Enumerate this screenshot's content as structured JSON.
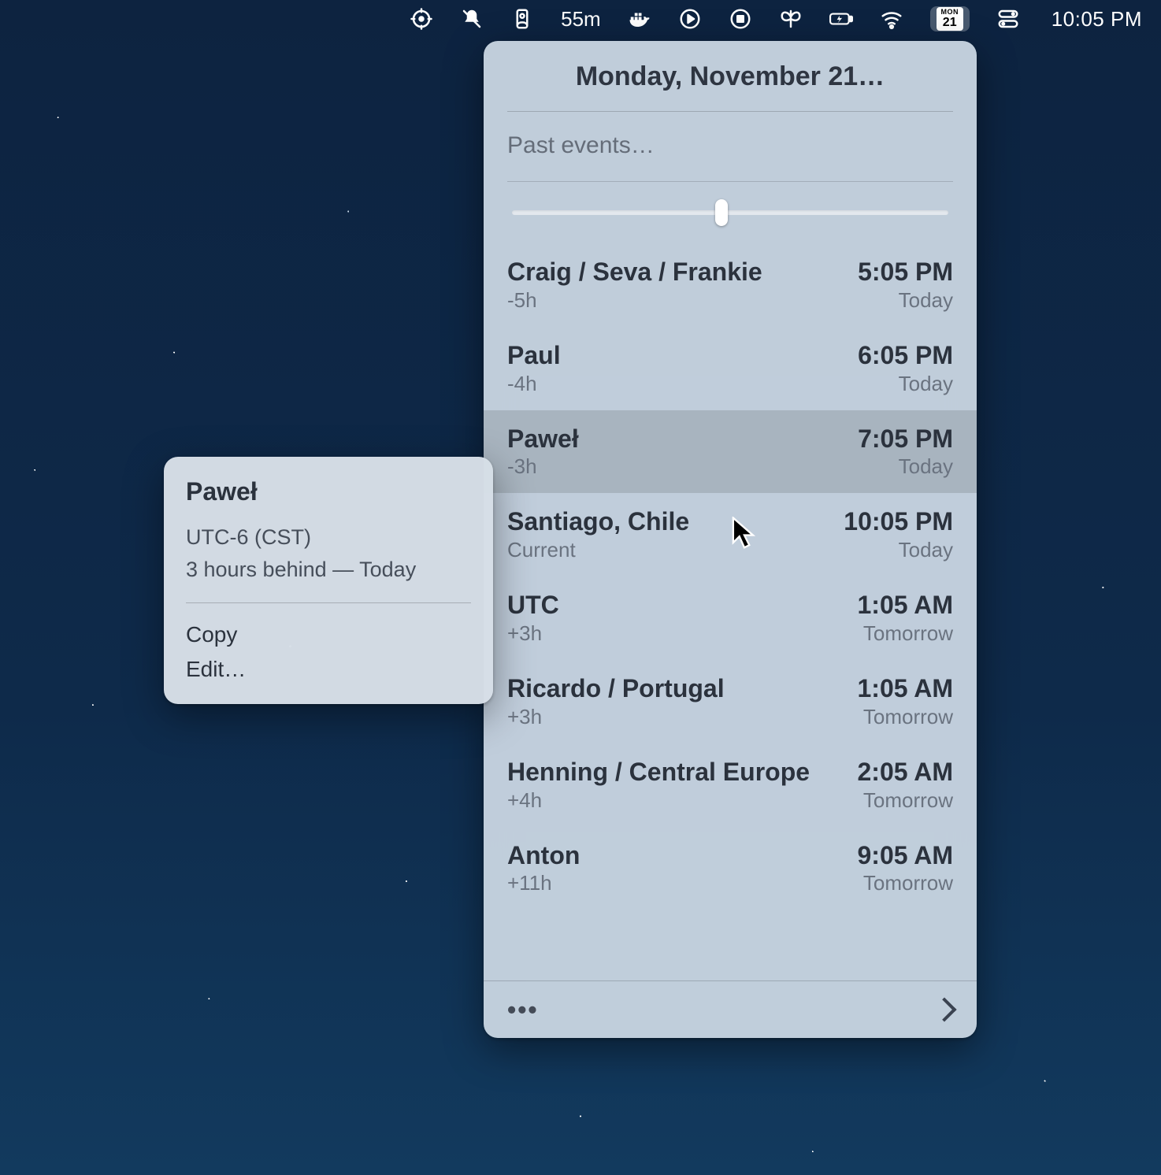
{
  "menubar": {
    "timer": "55m",
    "calendar_badge": {
      "dow": "MON",
      "day": "21"
    },
    "clock": "10:05 PM"
  },
  "panel": {
    "title": "Monday, November 21…",
    "past_events": "Past events…",
    "rows": [
      {
        "name": "Craig / Seva / Frankie",
        "offset": "-5h",
        "time": "5:05 PM",
        "day": "Today"
      },
      {
        "name": "Paul",
        "offset": "-4h",
        "time": "6:05 PM",
        "day": "Today"
      },
      {
        "name": "Paweł",
        "offset": "-3h",
        "time": "7:05 PM",
        "day": "Today"
      },
      {
        "name": "Santiago, Chile",
        "offset": "Current",
        "time": "10:05 PM",
        "day": "Today"
      },
      {
        "name": "UTC",
        "offset": "+3h",
        "time": "1:05 AM",
        "day": "Tomorrow"
      },
      {
        "name": "Ricardo / Portugal",
        "offset": "+3h",
        "time": "1:05 AM",
        "day": "Tomorrow"
      },
      {
        "name": "Henning / Central Europe",
        "offset": "+4h",
        "time": "2:05 AM",
        "day": "Tomorrow"
      },
      {
        "name": "Anton",
        "offset": "+11h",
        "time": "9:05 AM",
        "day": "Tomorrow"
      }
    ],
    "highlight_index": 2,
    "footer": {
      "more": "•••"
    }
  },
  "context_menu": {
    "name": "Paweł",
    "tz": "UTC-6 (CST)",
    "relative": "3 hours behind — Today",
    "items": [
      "Copy",
      "Edit…"
    ]
  }
}
